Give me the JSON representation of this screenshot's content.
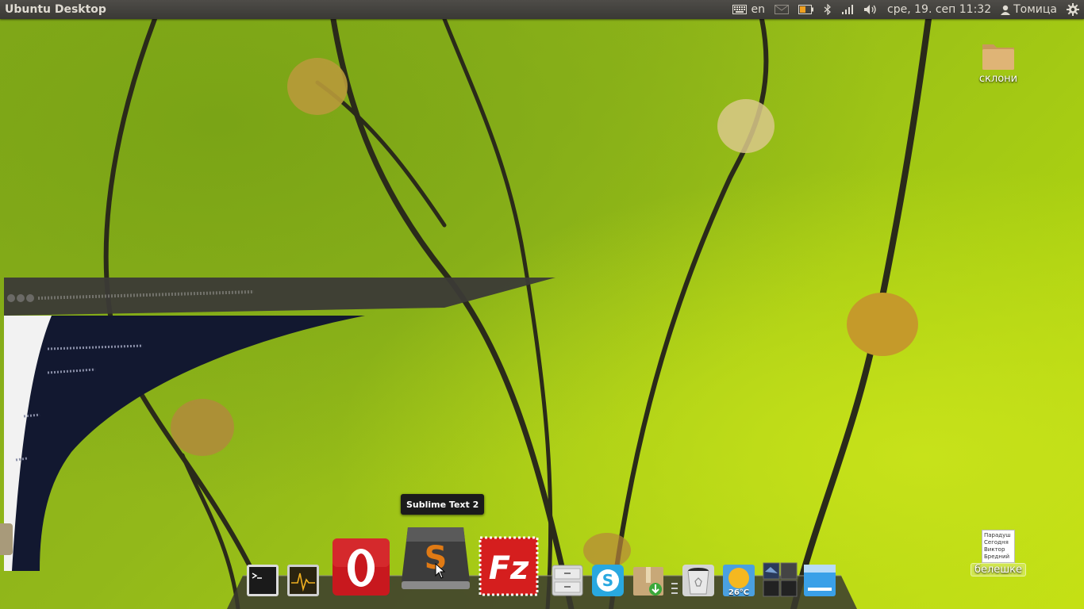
{
  "panel": {
    "title": "Ubuntu Desktop",
    "keyboard_layout": "en",
    "datetime": "сре, 19. сеп 11:32",
    "user": "Томица"
  },
  "desktop": {
    "folder_label": "склони",
    "notes_label": "белешке",
    "notes_preview": [
      "Парадуш",
      "Сегодня",
      "Виктор",
      "Бредний"
    ]
  },
  "dock": {
    "tooltip": "Sublime Text 2",
    "items": [
      {
        "id": "terminal",
        "name": "Terminal"
      },
      {
        "id": "system-monitor",
        "name": "System Monitor"
      },
      {
        "id": "opera",
        "name": "Opera"
      },
      {
        "id": "sublime",
        "name": "Sublime Text 2"
      },
      {
        "id": "filezilla",
        "name": "FileZilla"
      },
      {
        "id": "file-cabinet",
        "name": "Files"
      },
      {
        "id": "skype",
        "name": "Skype"
      },
      {
        "id": "archive",
        "name": "Archive Manager"
      },
      {
        "id": "trash",
        "name": "Trash"
      },
      {
        "id": "weather",
        "name": "Weather"
      },
      {
        "id": "workspaces",
        "name": "Workspaces"
      },
      {
        "id": "show-desktop",
        "name": "Show Desktop"
      }
    ],
    "weather_temp": "26°C"
  },
  "colors": {
    "panel_bg": "#3c3b37",
    "opera_red": "#c8181e",
    "filezilla_red": "#d51e1e",
    "skype_blue": "#29a8e0"
  }
}
